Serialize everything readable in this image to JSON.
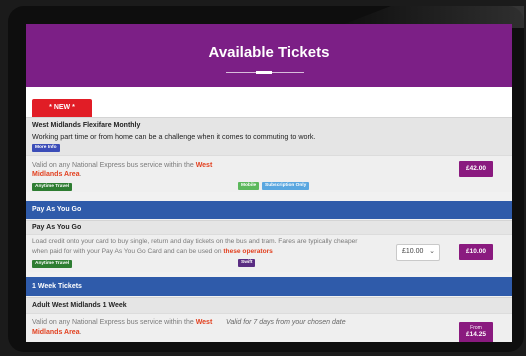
{
  "header": {
    "title": "Available Tickets"
  },
  "new_tab": {
    "label": "* NEW *"
  },
  "flexifare": {
    "title": "West Midlands Flexifare Monthly",
    "description": "Working part time or from home can be a challenge when it comes to commuting to work.",
    "more_info": "More Info",
    "validity_prefix": "Valid on any National Express bus service within the",
    "validity_link_1": "West",
    "validity_link_2": "Midlands Area",
    "validity_suffix": ".",
    "badges": [
      "Anytime Travel",
      "Mobile",
      "Subscription Only"
    ],
    "price": "£42.00"
  },
  "payg": {
    "band_label": "Pay As You Go",
    "title": "Pay As You Go",
    "desc_line1": "Load credit onto your card to buy single, return and day tickets on the bus and tram. Fares are typically cheaper",
    "desc_line2_prefix": "when paid for with your Pay As You Go Card and can be used on",
    "desc_link": "these operators",
    "badges": [
      "Anytime Travel",
      "Swift"
    ],
    "selected_amount": "£10.00",
    "price": "£10.00"
  },
  "week": {
    "band_label": "1 Week Tickets",
    "title": "Adult West Midlands 1 Week",
    "validity_prefix": "Valid on any National Express bus service within the",
    "validity_link_1": "West",
    "validity_link_2": "Midlands Area",
    "validity_suffix": ".",
    "duration": "Valid for 7 days from your chosen date",
    "price_from": "From",
    "price": "£14.25"
  },
  "colors": {
    "hero": "#7c1f86",
    "band": "#2f5baa",
    "new_tab": "#e11d26",
    "price": "#8a1a7f",
    "link": "#e2401f"
  },
  "icons": {
    "dropdown": "chevron-down-icon"
  }
}
